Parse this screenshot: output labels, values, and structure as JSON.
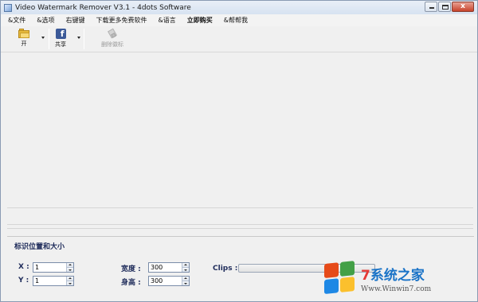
{
  "window": {
    "title": "Video Watermark Remover V3.1 - 4dots Software",
    "close_glyph": "x"
  },
  "menu": {
    "items": [
      "&文件",
      "&选项",
      "右键键",
      "下载更多免费软件",
      "&语言",
      "立即购买",
      "&帮帮我"
    ]
  },
  "toolbar": {
    "open_label": "开",
    "share_label": "共享",
    "share_glyph": "f",
    "remove_label": "删除徽标"
  },
  "panel": {
    "title": "标识位置和大小",
    "x_label": "X :",
    "x_value": "1",
    "y_label": "Y :",
    "y_value": "1",
    "width_label": "宽度 :",
    "width_value": "300",
    "height_label": "身高 :",
    "height_value": "300",
    "clips_label": "Clips :"
  },
  "watermark": {
    "seven": "7",
    "main_text": "系统之家",
    "url": "Www.Winwin7.com"
  },
  "colors": {
    "label_text": "#1e2b5a",
    "facebook": "#3b5998",
    "folder": "#e6b93c"
  }
}
